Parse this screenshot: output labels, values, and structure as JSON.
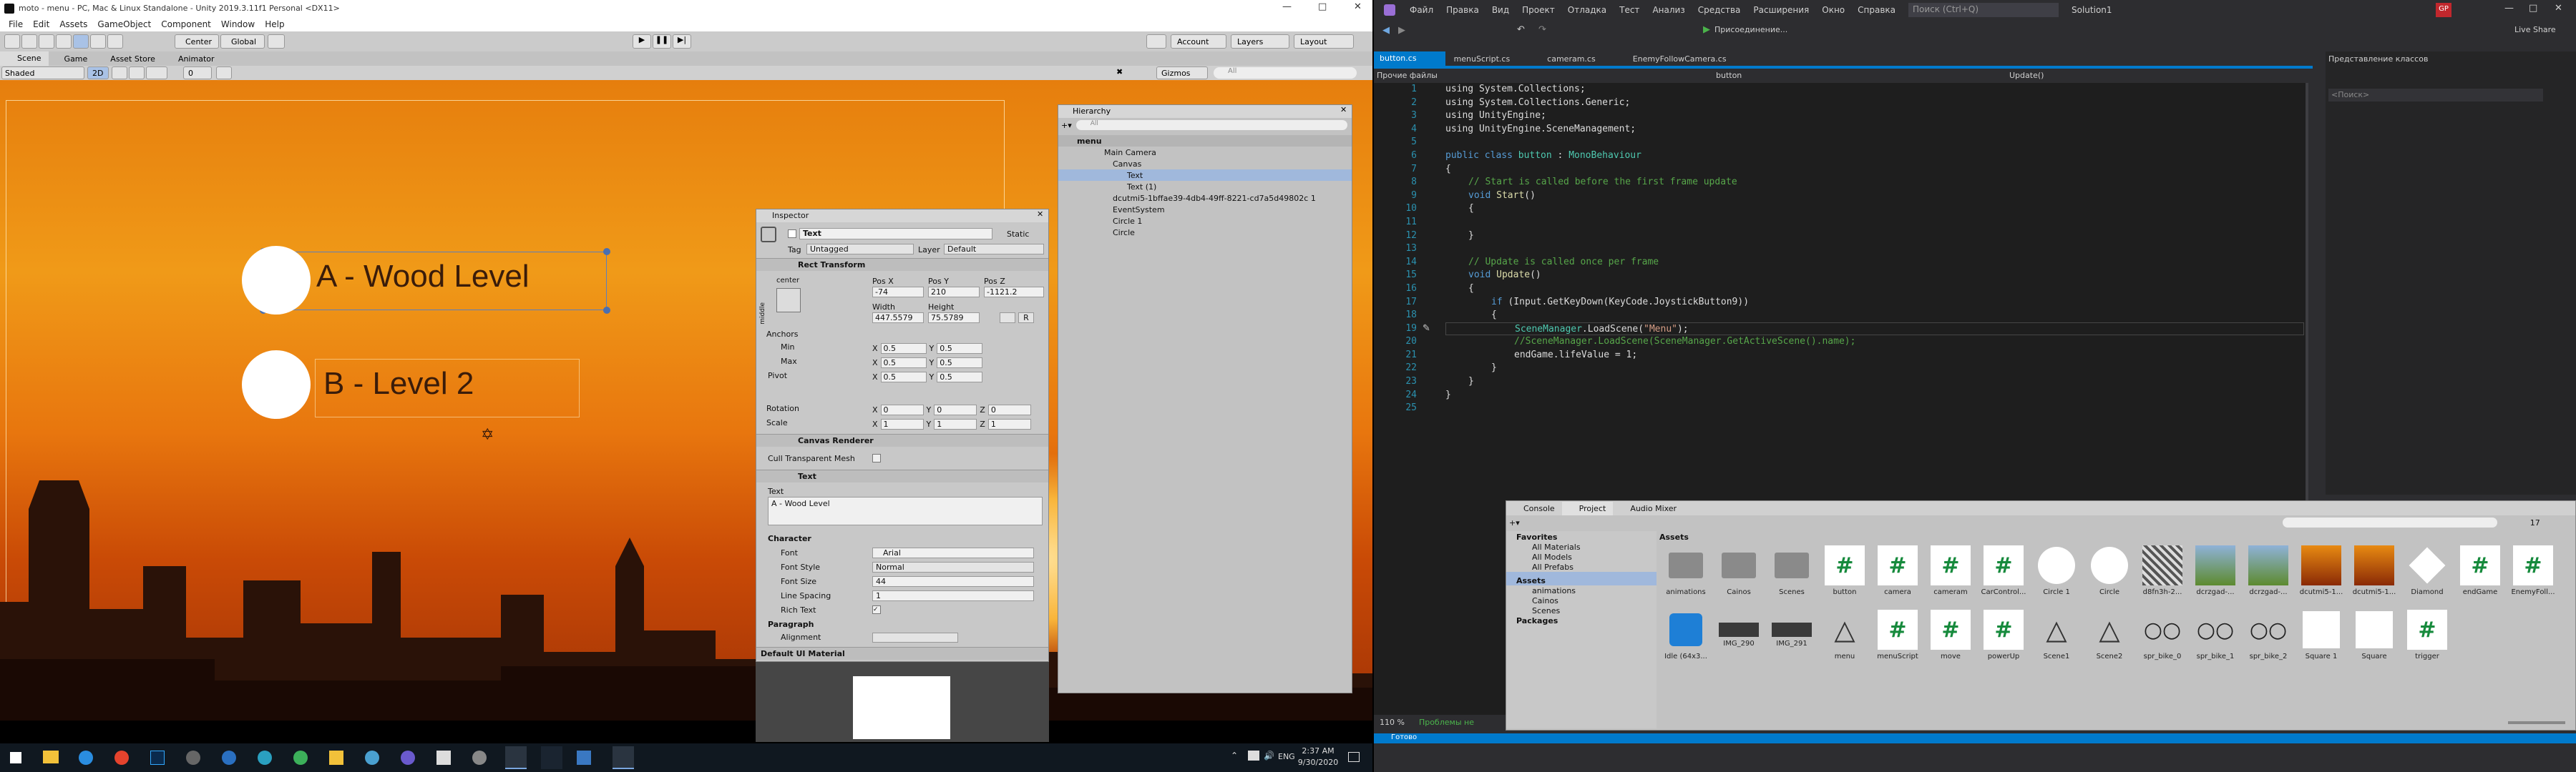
{
  "unity": {
    "title": "moto - menu - PC, Mac & Linux Standalone - Unity 2019.3.11f1 Personal <DX11>",
    "menu": [
      "File",
      "Edit",
      "Assets",
      "GameObject",
      "Component",
      "Window",
      "Help"
    ],
    "toolbar": {
      "center": "Center",
      "global": "Global",
      "account": "Account",
      "layers": "Layers",
      "layout": "Layout"
    },
    "tabs": {
      "scene": "Scene",
      "game": "Game",
      "asset_store": "Asset Store",
      "animator": "Animator"
    },
    "scene_bar": {
      "shaded": "Shaded",
      "mode": "2D",
      "gizmos": "Gizmos",
      "search": "All",
      "audio": "0"
    },
    "scene_labels": {
      "btn_a": "A - Wood Level",
      "btn_b": "B -  Level 2"
    },
    "hierarchy": {
      "title": "Hierarchy",
      "search": "All",
      "items": [
        "menu",
        "Main Camera",
        "Canvas",
        "Text",
        "Text (1)",
        "dcutmi5-1bffae39-4db4-49ff-8221-cd7a5d49802c 1",
        "EventSystem",
        "Circle 1",
        "Circle"
      ]
    },
    "inspector": {
      "title": "Inspector",
      "name": "Text",
      "static": "Static",
      "tag_label": "Tag",
      "tag": "Untagged",
      "layer_label": "Layer",
      "layer": "Default",
      "rect": {
        "title": "Rect Transform",
        "center": "center",
        "middle": "middle",
        "posx_l": "Pos X",
        "posy_l": "Pos Y",
        "posz_l": "Pos Z",
        "posx": "-74",
        "posy": "210",
        "posz": "-1121.2",
        "width_l": "Width",
        "height_l": "Height",
        "width": "447.5579",
        "height": "75.5789",
        "anchors": "Anchors",
        "min": "Min",
        "max": "Max",
        "pivot": "Pivot",
        "rotation": "Rotation",
        "scale": "Scale",
        "x": "X",
        "y": "Y",
        "z": "Z",
        "min_x": "0.5",
        "min_y": "0.5",
        "max_x": "0.5",
        "max_y": "0.5",
        "pivot_x": "0.5",
        "pivot_y": "0.5",
        "rot_x": "0",
        "rot_y": "0",
        "rot_z": "0",
        "sc_x": "1",
        "sc_y": "1",
        "sc_z": "1"
      },
      "renderer": {
        "title": "Canvas Renderer",
        "cull": "Cull Transparent Mesh"
      },
      "text": {
        "title": "Text",
        "label": "Text",
        "value": "A - Wood Level",
        "character": "Character",
        "font_l": "Font",
        "font": "Arial",
        "style_l": "Font Style",
        "style": "Normal",
        "size_l": "Font Size",
        "size": "44",
        "spacing_l": "Line Spacing",
        "spacing": "1",
        "rich_l": "Rich Text",
        "paragraph": "Paragraph",
        "alignment": "Alignment"
      },
      "material": "Default UI Material"
    }
  },
  "taskbar": {
    "time": "2:37 AM",
    "date": "9/30/2020",
    "lang": "ENG"
  },
  "vs": {
    "menu": [
      "Файл",
      "Правка",
      "Вид",
      "Проект",
      "Отладка",
      "Тест",
      "Анализ",
      "Средства",
      "Расширения",
      "Окно",
      "Справка"
    ],
    "search": "Поиск (Ctrl+Q)",
    "solution": "Solution1",
    "user": "GP",
    "live_share": "Live Share",
    "attach": "Присоединение...",
    "tabs": [
      "button.cs",
      "menuScript.cs",
      "cameram.cs",
      "EnemyFollowCamera.cs"
    ],
    "nav": {
      "misc": "Прочие файлы",
      "class": "button",
      "method": "Update()"
    },
    "lines": [
      "1",
      "2",
      "3",
      "4",
      "5",
      "6",
      "7",
      "8",
      "9",
      "10",
      "11",
      "12",
      "13",
      "14",
      "15",
      "16",
      "17",
      "18",
      "19",
      "20",
      "21",
      "22",
      "23",
      "24",
      "25"
    ],
    "code": {
      "l1": "using System.Collections;",
      "l2": "using System.Collections.Generic;",
      "l3": "using UnityEngine;",
      "l4": "using UnityEngine.SceneManagement;",
      "l6a": "public class ",
      "l6b": "button",
      ": MonoBehaviour": "",
      "l6c": " : ",
      "l6d": "MonoBehaviour",
      "l8": "// Start is called before the first frame update",
      "l9a": "void ",
      "l9b": "Start",
      "l9c": "()",
      "brace_open": "{",
      "brace_close": "}",
      "l15": "// Update is called once per frame",
      "l16a": "void ",
      "l16b": "Update",
      "l16c": "()",
      "l18a": "if ",
      "l18b": "(Input.GetKeyDown(KeyCode.JoystickButton9))",
      "l20a": "SceneManager",
      "l20b": ".LoadScene(",
      "l20c": "\"Menu\"",
      "l20d": ");",
      "l21": "//SceneManager.LoadScene(SceneManager.GetActiveScene().name);",
      "l22a": "endGame",
      "l22b": ".lifeValue = 1;"
    },
    "zoom": "110 %",
    "problems": "Проблемы не",
    "status": "Готово",
    "class_view": {
      "title": "Представление классов",
      "search": "<Поиск>"
    },
    "bottom": {
      "console": "Console",
      "project": "Project",
      "audio": "Audio Mixer",
      "assets_header": "Assets",
      "count": "17",
      "tree": [
        "Favorites",
        "All Materials",
        "All Models",
        "All Prefabs",
        "Assets",
        "animations",
        "Cainos",
        "Scenes",
        "Packages"
      ],
      "assets": [
        "animations",
        "Cainos",
        "Scenes",
        "button",
        "camera",
        "cameram",
        "CarControl...",
        "Circle 1",
        "Circle",
        "d8fn3h-2...",
        "dcrzgad-...",
        "dcrzgad-...",
        "dcutmi5-1...",
        "dcutmi5-1...",
        "Diamond",
        "endGame",
        "EnemyFoll...",
        "Idle (64x3...",
        "IMG_290",
        "IMG_291",
        "menu",
        "menuScript",
        "move",
        "powerUp",
        "Scene1",
        "Scene2",
        "spr_bike_0",
        "spr_bike_1",
        "spr_bike_2",
        "Square 1",
        "Square",
        "trigger"
      ]
    }
  },
  "colors": {
    "vs_blue": "#007acc",
    "unity_blue": "#3a72b0",
    "sunset_top": "#e2880f",
    "sunset_bottom": "#b63b06"
  }
}
